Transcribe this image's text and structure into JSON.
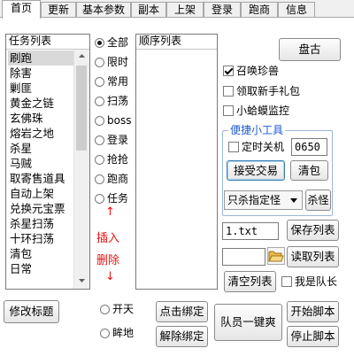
{
  "tabs": [
    "首页",
    "更新",
    "基本参数",
    "副本",
    "上架",
    "登录",
    "跑商",
    "信息"
  ],
  "task_list": {
    "header": "任务列表",
    "items": [
      "刷跑",
      "除害",
      "剿匪",
      "黄金之链",
      "玄佛珠",
      "熔岩之地",
      "杀星",
      "马贼",
      "取寄售道具",
      "自动上架",
      "兑换元宝票",
      "杀星扫荡",
      "十环扫荡",
      "清包",
      "日常"
    ]
  },
  "filters": {
    "options": [
      "全部",
      "限时",
      "常用",
      "扫荡",
      "boss",
      "登录",
      "抢抢",
      "跑商",
      "任务"
    ],
    "selected": "全部",
    "insert_label": "插入",
    "delete_label": "删除",
    "arrow_up": "↑",
    "arrow_down": "↓"
  },
  "order_list": {
    "header": "顺序列表"
  },
  "right_panel": {
    "pangu_label": "盘古",
    "summon_pet_label": "召唤珍兽",
    "summon_pet_checked": true,
    "newbie_pack_label": "领取新手礼包",
    "newbie_pack_checked": false,
    "toad_monitor_label": "小蛤蟆监控",
    "toad_monitor_checked": false
  },
  "tools": {
    "title": "便捷小工具",
    "shutdown_label": "定时关机",
    "shutdown_checked": false,
    "shutdown_time": "0650",
    "accept_trade_label": "接受交易",
    "clear_bag_label": "清包",
    "kill_select": "只杀指定怪",
    "kill_label": "杀怪"
  },
  "file": {
    "filename": "1.txt",
    "save_list_label": "保存列表",
    "load_list_label": "读取列表",
    "path_value": "",
    "clear_list_label": "清空列表",
    "is_captain_label": "我是队长",
    "is_captain_checked": false
  },
  "bottom": {
    "edit_title_label": "修改标题",
    "open_sky_label": "开天",
    "open_sky_selected": false,
    "fall_ground_label": "眸地",
    "fall_ground_selected": false,
    "click_bind_label": "点击绑定",
    "unbind_label": "解除绑定",
    "team_one_key_label": "队员一键爽",
    "start_script_label": "开始脚本",
    "stop_script_label": "停止脚本"
  },
  "colors": {
    "accent_blue": "#1c5bd1",
    "red_text": "#e11111"
  }
}
